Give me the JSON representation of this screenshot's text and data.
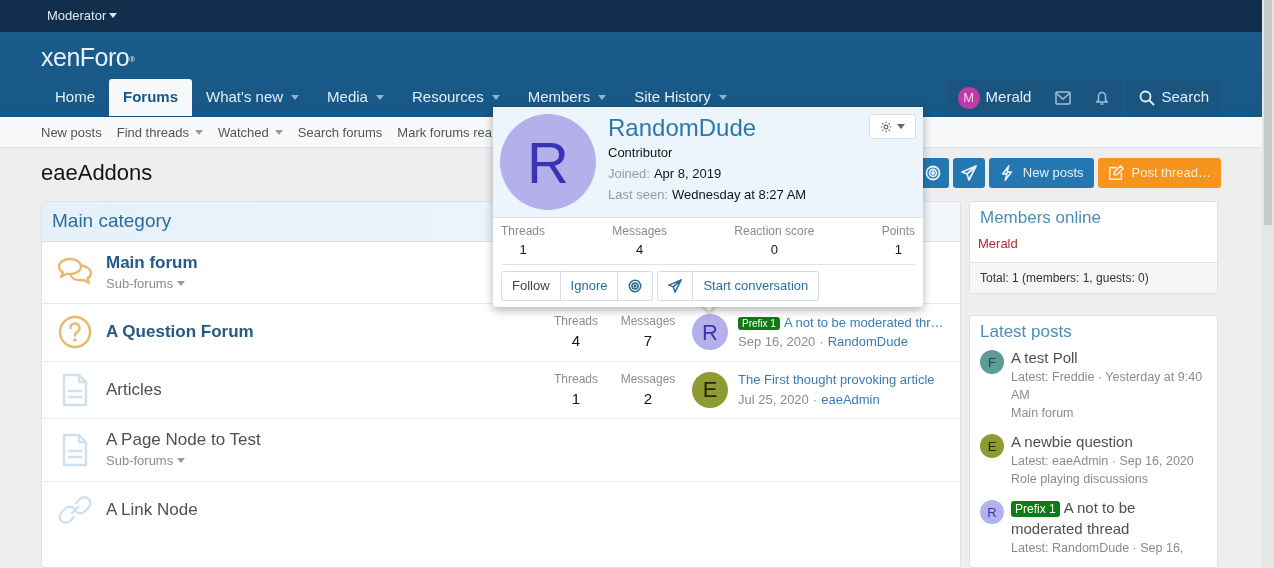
{
  "moderator_bar": {
    "label": "Moderator"
  },
  "logo": {
    "text": "xenForo",
    "mark": "®"
  },
  "nav_tabs": [
    {
      "label": "Home",
      "selected": false,
      "dropdown": false
    },
    {
      "label": "Forums",
      "selected": true,
      "dropdown": false
    },
    {
      "label": "What's new",
      "selected": false,
      "dropdown": true
    },
    {
      "label": "Media",
      "selected": false,
      "dropdown": true
    },
    {
      "label": "Resources",
      "selected": false,
      "dropdown": true
    },
    {
      "label": "Members",
      "selected": false,
      "dropdown": true
    },
    {
      "label": "Site History",
      "selected": false,
      "dropdown": true
    }
  ],
  "user_menu": {
    "avatar_letter": "M",
    "color": "#c03aa8",
    "name": "Merald"
  },
  "search_button": {
    "label": "Search"
  },
  "sub_nav": [
    {
      "label": "New posts",
      "dropdown": false
    },
    {
      "label": "Find threads",
      "dropdown": true
    },
    {
      "label": "Watched",
      "dropdown": true
    },
    {
      "label": "Search forums",
      "dropdown": false
    },
    {
      "label": "Mark forums rea",
      "dropdown": false
    }
  ],
  "page_title": "eaeAddons",
  "action_buttons": [
    {
      "kind": "watch"
    },
    {
      "kind": "message"
    },
    {
      "kind": "new_posts",
      "label": "New posts"
    },
    {
      "kind": "post_thread",
      "label": "Post thread…"
    }
  ],
  "category": {
    "title": "Main category",
    "nodes": [
      {
        "kind": "forum",
        "title": "Main forum",
        "unread": true,
        "subforums": "Sub-forums"
      },
      {
        "kind": "question",
        "title": "A Question Forum",
        "unread": true,
        "stats": [
          {
            "label": "Threads",
            "value": "4"
          },
          {
            "label": "Messages",
            "value": "7"
          }
        ],
        "last_post": {
          "avatar_letter": "R",
          "color": "#b4b0ec",
          "prefix": "Prefix 1",
          "title": "A not to be moderated thr…",
          "date": "Sep 16, 2020",
          "separator": "·",
          "author": "RandomDude"
        }
      },
      {
        "kind": "article",
        "title": "Articles",
        "unread": false,
        "stats": [
          {
            "label": "Threads",
            "value": "1"
          },
          {
            "label": "Messages",
            "value": "2"
          }
        ],
        "last_post": {
          "avatar_letter": "E",
          "color": "#8e9a33",
          "title": "The First thought provoking article",
          "date": "Jul 25, 2020",
          "separator": "·",
          "author": "eaeAdmin"
        }
      },
      {
        "kind": "page",
        "title": "A Page Node to Test",
        "unread": false,
        "subforums": "Sub-forums"
      },
      {
        "kind": "link",
        "title": "A Link Node",
        "unread": false
      }
    ]
  },
  "members_online": {
    "title": "Members online",
    "members": [
      "Merald"
    ],
    "total": "Total: 1 (members: 1, guests: 0)"
  },
  "latest_posts": {
    "title": "Latest posts",
    "items": [
      {
        "avatar_letter": "F",
        "color": "#5e9c97",
        "title": "A test Poll",
        "meta": "Latest: Freddie · Yesterday at 9:40 AM",
        "forum": "Main forum"
      },
      {
        "avatar_letter": "E",
        "color": "#8e9a33",
        "title": "A newbie question",
        "meta": "Latest: eaeAdmin · Sep 16, 2020",
        "forum": "Role playing discussions"
      },
      {
        "avatar_letter": "R",
        "color": "#b4b0ec",
        "prefix": "Prefix 1",
        "title": "A not to be moderated thread",
        "meta": "Latest: RandomDude · Sep 16,"
      }
    ]
  },
  "profile_popup": {
    "avatar_letter": "R",
    "color": "#b4b0ec",
    "name": "RandomDude",
    "user_title": "Contributor",
    "fields": [
      {
        "label": "Joined:",
        "value": "Apr 8, 2019"
      },
      {
        "label": "Last seen:",
        "value": "Wednesday at 8:27 AM"
      }
    ],
    "stats": [
      {
        "label": "Threads",
        "value": "1"
      },
      {
        "label": "Messages",
        "value": "4"
      },
      {
        "label": "Reaction score",
        "value": "0"
      },
      {
        "label": "Points",
        "value": "1"
      }
    ],
    "button_groups": [
      [
        {
          "kind": "text",
          "label": "Follow"
        },
        {
          "kind": "text",
          "label": "Ignore"
        },
        {
          "kind": "watch"
        }
      ],
      [
        {
          "kind": "message"
        },
        {
          "kind": "text",
          "label": "Start conversation"
        }
      ]
    ]
  }
}
